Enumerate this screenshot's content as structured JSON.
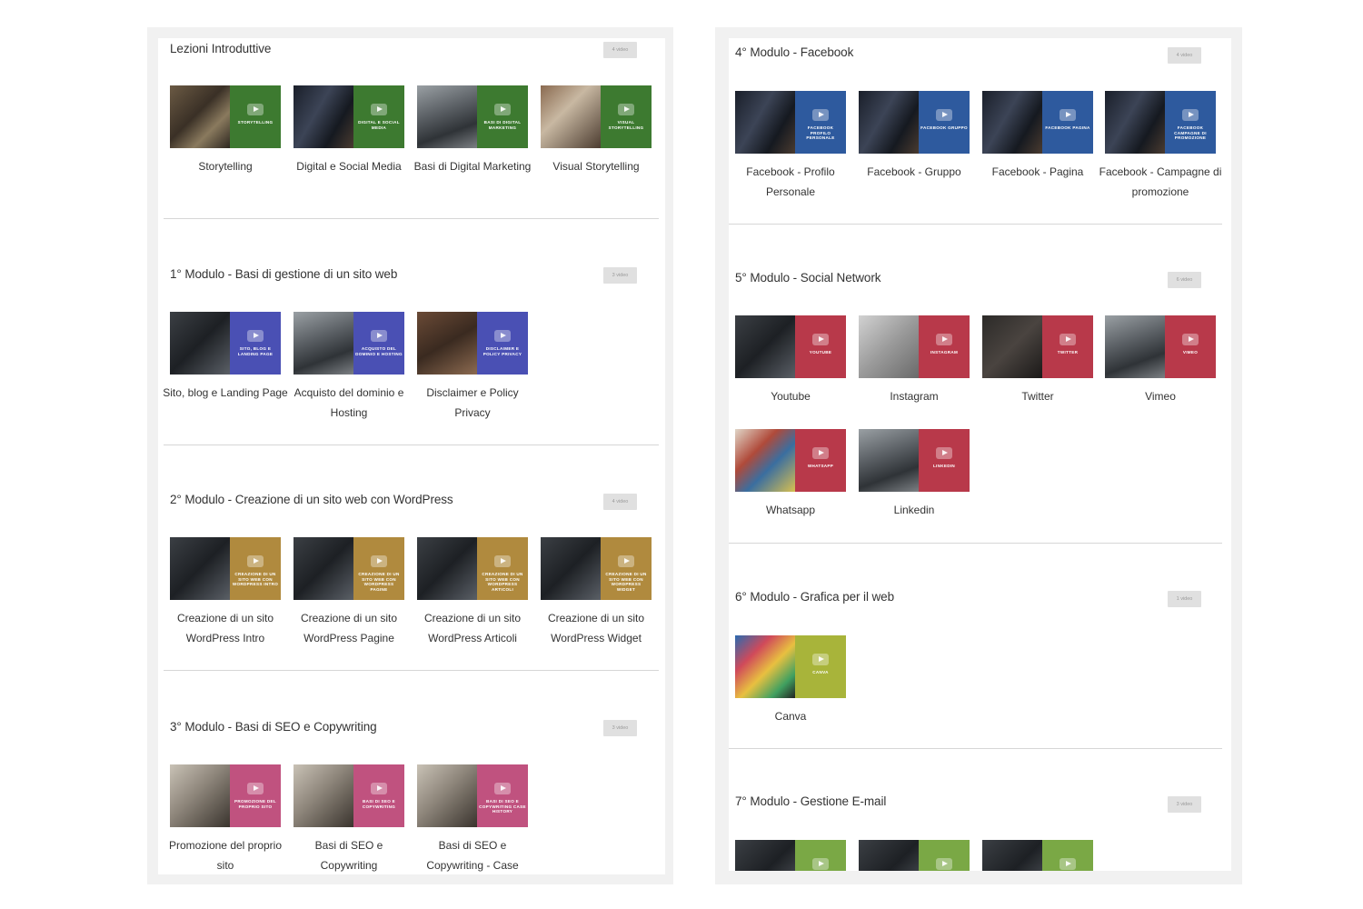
{
  "colors": {
    "green": "#3d7a30",
    "blue": "#4a50b4",
    "gold": "#b08a3e",
    "pink": "#c0527f",
    "facebook": "#2e5a9e",
    "red": "#b8394a",
    "yellowgreen": "#a8b43a",
    "lime": "#7aa845"
  },
  "left_column": {
    "sections": [
      {
        "title": "Lezioni Introduttive",
        "badge": "4 video",
        "videos": [
          {
            "label": "Storytelling",
            "caption": "STORYTELLING",
            "photo": "ph-desk",
            "color": "green"
          },
          {
            "label": "Digital e Social Media",
            "caption": "DIGITAL E SOCIAL MEDIA",
            "photo": "ph-phone",
            "color": "green"
          },
          {
            "label": "Basi di Digital Marketing",
            "caption": "BASI DI DIGITAL MARKETING",
            "photo": "ph-office",
            "color": "green"
          },
          {
            "label": "Visual Storytelling",
            "caption": "VISUAL STORYTELLING",
            "photo": "ph-food",
            "color": "green"
          }
        ]
      },
      {
        "title": "1° Modulo - Basi di gestione di un sito web",
        "badge": "3 video",
        "videos": [
          {
            "label": "Sito, blog e Landing Page",
            "caption": "SITO, BLOG E LANDING PAGE",
            "photo": "ph-laptop",
            "color": "blue"
          },
          {
            "label": "Acquisto del dominio e Hosting",
            "caption": "ACQUISTO DEL DOMINIO E HOSTING",
            "photo": "ph-office",
            "color": "blue"
          },
          {
            "label": "Disclaimer e Policy Privacy",
            "caption": "DISCLAIMER E POLICY PRIVACY",
            "photo": "ph-books",
            "color": "blue"
          }
        ]
      },
      {
        "title": "2° Modulo - Creazione di un sito web con WordPress",
        "badge": "4 video",
        "videos": [
          {
            "label": "Creazione di un sito WordPress Intro",
            "caption": "CREAZIONE DI UN SITO WEB CON WORDPRESS INTRO",
            "photo": "ph-laptop",
            "color": "gold"
          },
          {
            "label": "Creazione di un sito WordPress Pagine",
            "caption": "CREAZIONE DI UN SITO WEB CON WORDPRESS PAGINE",
            "photo": "ph-laptop",
            "color": "gold"
          },
          {
            "label": "Creazione di un sito WordPress Articoli",
            "caption": "CREAZIONE DI UN SITO WEB CON WORDPRESS ARTICOLI",
            "photo": "ph-laptop",
            "color": "gold"
          },
          {
            "label": "Creazione di un sito WordPress Widget",
            "caption": "CREAZIONE DI UN SITO WEB CON WORDPRESS WIDGET",
            "photo": "ph-laptop",
            "color": "gold"
          }
        ]
      },
      {
        "title": "3° Modulo - Basi di SEO e Copywriting",
        "badge": "3 video",
        "videos": [
          {
            "label": "Promozione del proprio sito",
            "caption": "PROMOZIONE DEL PROPRIO SITO",
            "photo": "ph-paper",
            "color": "pink"
          },
          {
            "label": "Basi di SEO e Copywriting",
            "caption": "BASI DI SEO E COPYWRITING",
            "photo": "ph-paper",
            "color": "pink"
          },
          {
            "label": "Basi di SEO e Copywriting - Case",
            "caption": "BASI DI SEO E COPYWRITING CASE HISTORY",
            "photo": "ph-paper",
            "color": "pink"
          }
        ]
      }
    ]
  },
  "right_column": {
    "sections": [
      {
        "title": "4° Modulo - Facebook",
        "badge": "4 video",
        "videos": [
          {
            "label": "Facebook - Profilo Personale",
            "caption": "FACEBOOK PROFILO PERSONALE",
            "photo": "ph-phone",
            "color": "facebook"
          },
          {
            "label": "Facebook - Gruppo",
            "caption": "FACEBOOK GRUPPO",
            "photo": "ph-phone",
            "color": "facebook"
          },
          {
            "label": "Facebook - Pagina",
            "caption": "FACEBOOK PAGINA",
            "photo": "ph-phone",
            "color": "facebook"
          },
          {
            "label": "Facebook - Campagne di promozione",
            "caption": "FACEBOOK CAMPAGNE DI PROMOZIONE",
            "photo": "ph-phone",
            "color": "facebook"
          }
        ]
      },
      {
        "title": "5° Modulo - Social Network",
        "badge": "6 video",
        "videos": [
          {
            "label": "Youtube",
            "caption": "YOUTUBE",
            "photo": "ph-laptop",
            "color": "red"
          },
          {
            "label": "Instagram",
            "caption": "INSTAGRAM",
            "photo": "ph-grey",
            "color": "red"
          },
          {
            "label": "Twitter",
            "caption": "TWITTER",
            "photo": "ph-dark",
            "color": "red"
          },
          {
            "label": "Vimeo",
            "caption": "VIMEO",
            "photo": "ph-office",
            "color": "red"
          },
          {
            "label": "Whatsapp",
            "caption": "WHATSAPP",
            "photo": "ph-apps",
            "color": "red"
          },
          {
            "label": "Linkedin",
            "caption": "LINKEDIN",
            "photo": "ph-office",
            "color": "red"
          }
        ]
      },
      {
        "title": "6° Modulo - Grafica per il web",
        "badge": "1 video",
        "videos": [
          {
            "label": "Canva",
            "caption": "CANVA",
            "photo": "ph-colorful",
            "color": "yellowgreen"
          }
        ]
      },
      {
        "title": "7° Modulo - Gestione E-mail",
        "badge": "3 video",
        "videos": [
          {
            "label": "",
            "caption": "",
            "photo": "ph-laptop",
            "color": "lime"
          },
          {
            "label": "",
            "caption": "",
            "photo": "ph-laptop",
            "color": "lime"
          },
          {
            "label": "",
            "caption": "",
            "photo": "ph-laptop",
            "color": "lime"
          }
        ]
      }
    ]
  }
}
